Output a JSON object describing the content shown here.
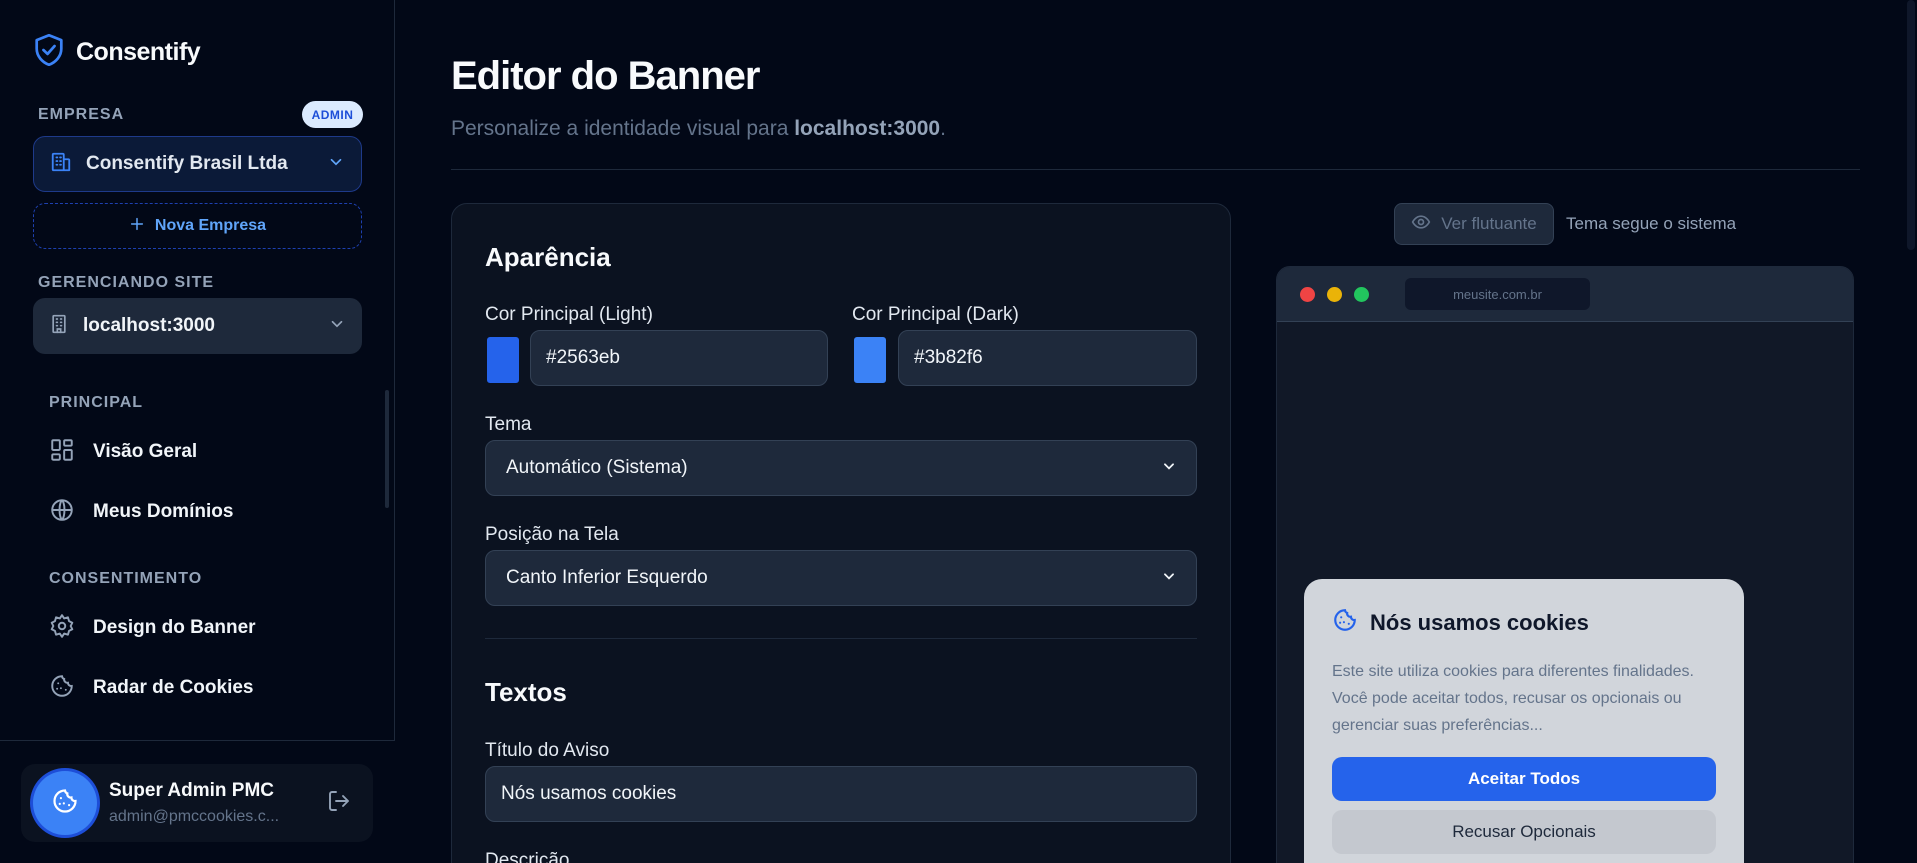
{
  "brand": {
    "name": "Consentify"
  },
  "sidebar": {
    "company_label": "EMPRESA",
    "admin_badge": "ADMIN",
    "company_name": "Consentify Brasil Ltda",
    "new_company": "Nova Empresa",
    "site_label": "GERENCIANDO SITE",
    "site_name": "localhost:3000",
    "sections": [
      {
        "label": "PRINCIPAL",
        "items": [
          {
            "label": "Visão Geral",
            "icon": "grid-icon"
          },
          {
            "label": "Meus Domínios",
            "icon": "globe-icon"
          }
        ]
      },
      {
        "label": "CONSENTIMENTO",
        "items": [
          {
            "label": "Design do Banner",
            "icon": "gear-icon"
          },
          {
            "label": "Radar de Cookies",
            "icon": "cookie-icon"
          }
        ]
      }
    ],
    "user": {
      "name": "Super Admin PMC",
      "email": "admin@pmccookies.c..."
    }
  },
  "main": {
    "title": "Editor do Banner",
    "subtitle_prefix": "Personalize a identidade visual para ",
    "subtitle_site": "localhost:3000",
    "subtitle_suffix": "."
  },
  "editor": {
    "appearance_heading": "Aparência",
    "color_light_label": "Cor Principal (Light)",
    "color_light_value": "#2563eb",
    "color_dark_label": "Cor Principal (Dark)",
    "color_dark_value": "#3b82f6",
    "theme_label": "Tema",
    "theme_value": "Automático (Sistema)",
    "position_label": "Posição na Tela",
    "position_value": "Canto Inferior Esquerdo",
    "texts_heading": "Textos",
    "notice_title_label": "Título do Aviso",
    "notice_title_value": "Nós usamos cookies",
    "description_label": "Descrição"
  },
  "preview": {
    "float_button": "Ver flutuante",
    "theme_note": "Tema segue o sistema",
    "url": "meusite.com.br",
    "banner_title": "Nós usamos cookies",
    "banner_desc": "Este site utiliza cookies para diferentes finalidades. Você pode aceitar todos, recusar os opcionais ou gerenciar suas preferências...",
    "accept": "Aceitar Todos",
    "reject": "Recusar Opcionais"
  },
  "colors": {
    "accent": "#2563eb",
    "accent_dark": "#3b82f6",
    "background": "#020817",
    "panel": "#0b1220"
  }
}
